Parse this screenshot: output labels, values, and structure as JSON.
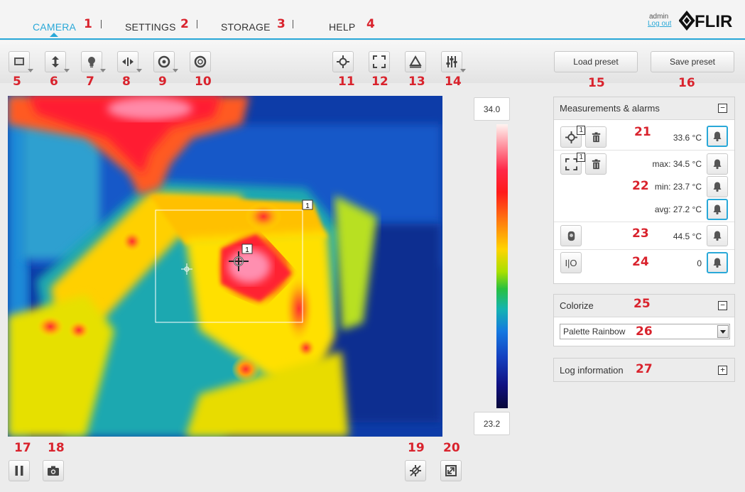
{
  "nav": {
    "tabs": [
      {
        "label": "CAMERA",
        "marker": "1"
      },
      {
        "label": "SETTINGS",
        "marker": "2"
      },
      {
        "label": "STORAGE",
        "marker": "3"
      },
      {
        "label": "HELP",
        "marker": "4"
      }
    ],
    "user": "admin",
    "logout": "Log out",
    "logo": "FLIR"
  },
  "toolbar": {
    "markers": [
      "5",
      "6",
      "7",
      "8",
      "9",
      "10",
      "11",
      "12",
      "13",
      "14",
      "15",
      "16"
    ],
    "load_preset": "Load preset",
    "save_preset": "Save preset"
  },
  "thermal": {
    "box_label": "1",
    "spot_label": "1"
  },
  "scale": {
    "max": "34.0",
    "min": "23.2"
  },
  "bottom": {
    "markers": [
      "17",
      "18",
      "19",
      "20"
    ]
  },
  "measurements": {
    "title": "Measurements & alarms",
    "toggle": "−",
    "markers": [
      "21",
      "22",
      "23",
      "24"
    ],
    "spot": {
      "badge": "1",
      "value": "33.6 °C"
    },
    "box": {
      "badge": "1",
      "max": "max: 34.5 °C",
      "min": "min: 23.7 °C",
      "avg": "avg: 27.2 °C"
    },
    "internal": {
      "value": "44.5 °C"
    },
    "io": {
      "label": "I|O",
      "value": "0"
    }
  },
  "colorize": {
    "title": "Colorize",
    "toggle": "−",
    "marker": "25",
    "palette": "Palette Rainbow",
    "select_marker": "26"
  },
  "log": {
    "title": "Log information",
    "toggle": "+",
    "marker": "27"
  },
  "colors": {
    "accent": "#29a8d8",
    "marker": "#d9232d"
  }
}
